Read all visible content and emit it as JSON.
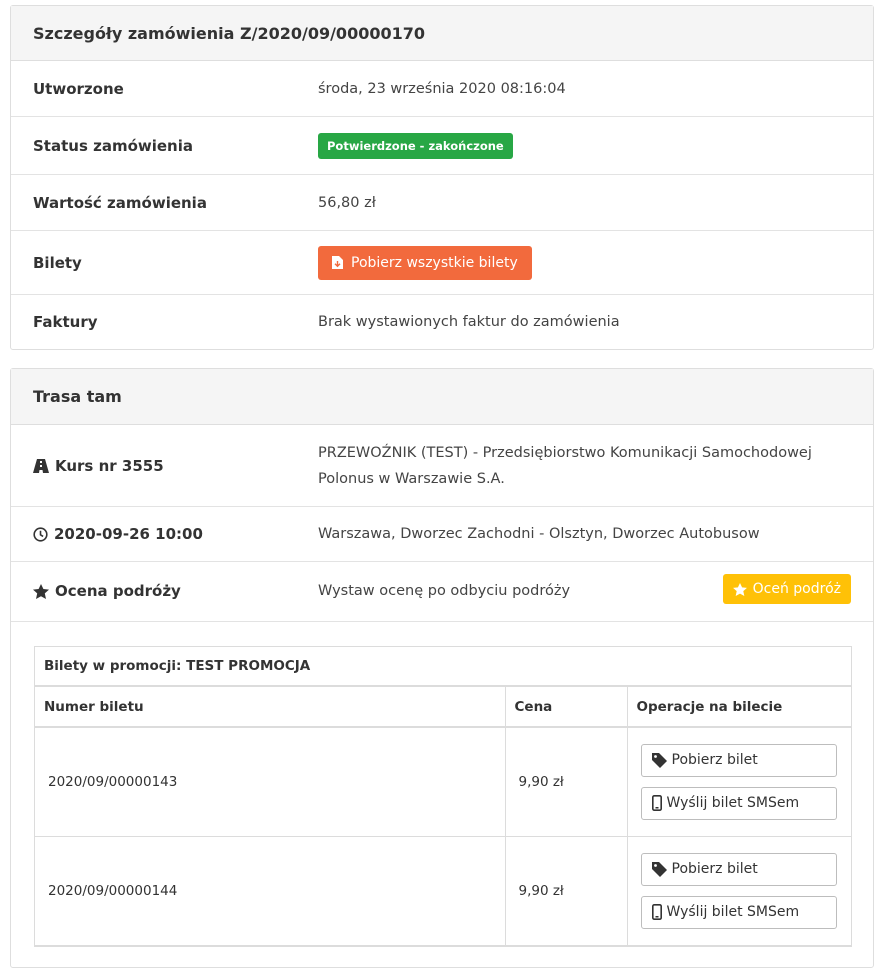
{
  "order": {
    "title": "Szczegóły zamówienia Z/2020/09/00000170",
    "rows": {
      "created_label": "Utworzone",
      "created_value": "środa, 23 września 2020 08:16:04",
      "status_label": "Status zamówienia",
      "status_value": "Potwierdzone - zakończone",
      "amount_label": "Wartość zamówienia",
      "amount_value": "56,80 zł",
      "tickets_label": "Bilety",
      "tickets_button": "Pobierz wszystkie bilety",
      "invoices_label": "Faktury",
      "invoices_value": "Brak wystawionych faktur do zamówienia"
    }
  },
  "route": {
    "title": "Trasa tam",
    "course_label": "Kurs nr 3555",
    "course_value": "PRZEWOŹNIK (TEST) - Przedsiębiorstwo Komunikacji Samochodowej Polonus w Warszawie S.A.",
    "datetime_label": "2020-09-26 10:00",
    "datetime_value": "Warszawa, Dworzec Zachodni - Olsztyn, Dworzec Autobusow",
    "rating_label": "Ocena podróży",
    "rating_value": "Wystaw ocenę po odbyciu podróży",
    "rating_button": "Oceń podróż"
  },
  "promo": {
    "title": "Bilety w promocji: TEST PROMOCJA",
    "columns": [
      "Numer biletu",
      "Cena",
      "Operacje na bilecie"
    ],
    "tickets": [
      {
        "number": "2020/09/00000143",
        "price": "9,90 zł",
        "download": "Pobierz bilet",
        "sms": "Wyślij bilet SMSem"
      },
      {
        "number": "2020/09/00000144",
        "price": "9,90 zł",
        "download": "Pobierz bilet",
        "sms": "Wyślij bilet SMSem"
      }
    ]
  },
  "colors": {
    "status_badge": "#28a745",
    "download_all": "#f26a3d",
    "rate_button": "#ffc107"
  },
  "icons": {
    "tickets_button": "file-download-icon",
    "course": "bus-icon",
    "datetime": "clock-icon",
    "rating": "star-icon",
    "download": "tag-icon",
    "sms": "mobile-phone-icon"
  }
}
